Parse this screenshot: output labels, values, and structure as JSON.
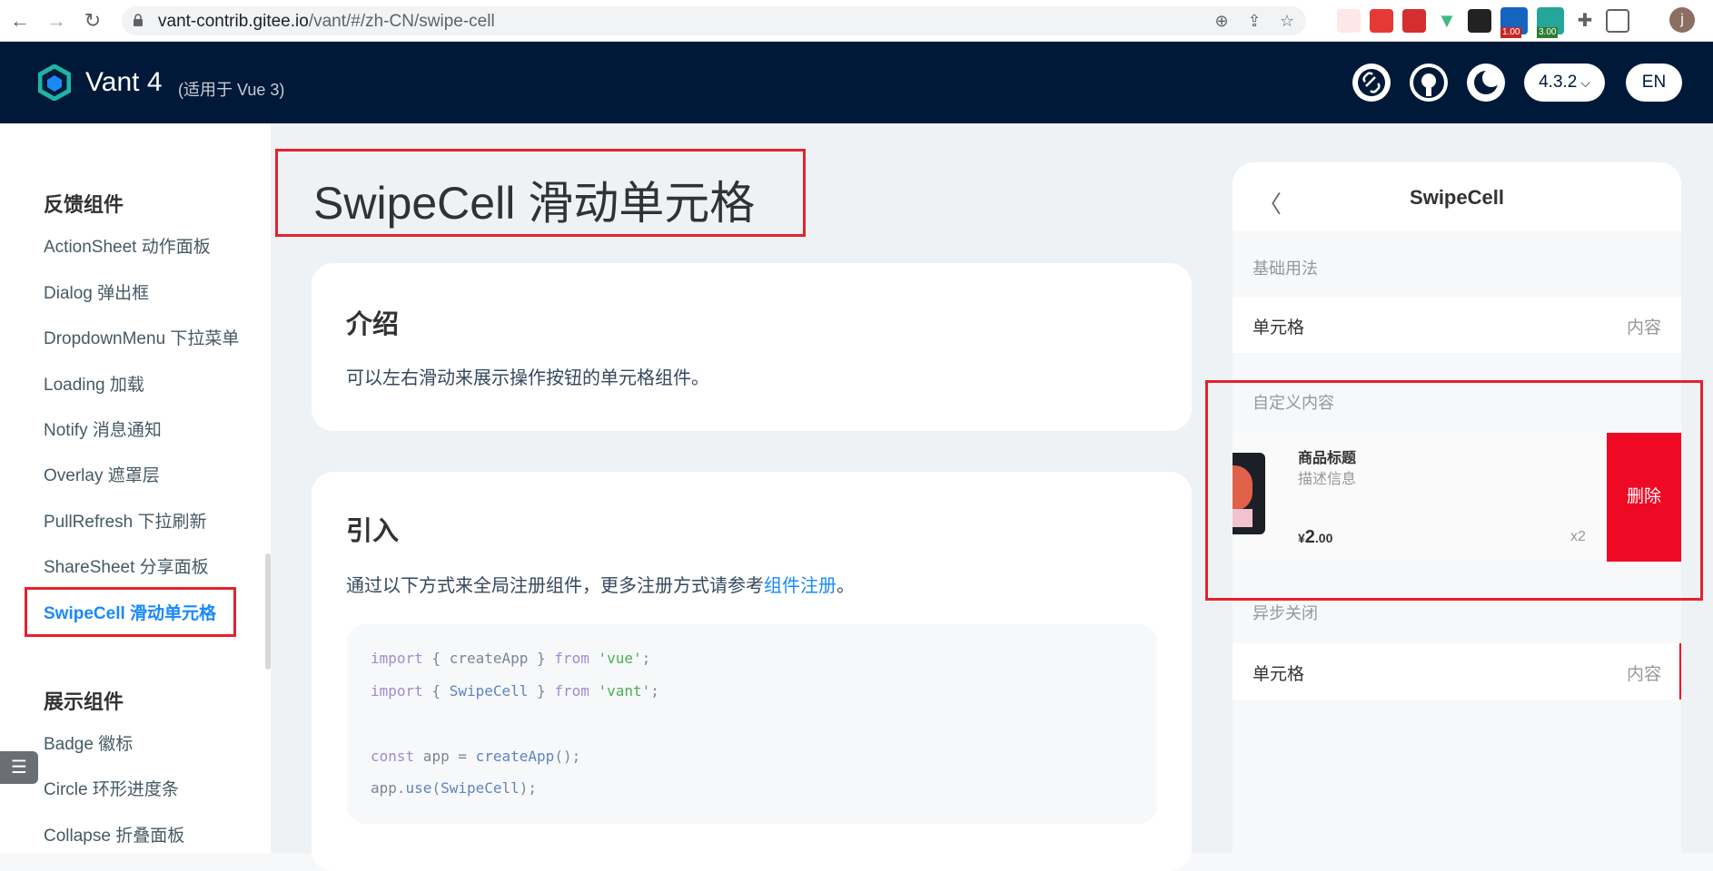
{
  "browser": {
    "url_host": "vant-contrib.gitee.io",
    "url_path": "/vant/#/zh-CN/swipe-cell",
    "ext_badge_1": "1.00",
    "ext_badge_2": "3.00",
    "avatar_letter": "j",
    "icons": [
      "back-icon",
      "forward-icon",
      "reload-icon",
      "lock-icon",
      "zoom-icon",
      "share-icon",
      "star-icon",
      "extensions-icon",
      "sidebar-icon"
    ]
  },
  "header": {
    "brand": "Vant 4",
    "brand_sub": "(适用于 Vue 3)",
    "version": "4.3.2",
    "lang": "EN",
    "colors": {
      "bg": "#001938",
      "accent": "#1989fa"
    }
  },
  "sidebar": {
    "groups": [
      {
        "title": "反馈组件",
        "items": [
          "ActionSheet 动作面板",
          "Dialog 弹出框",
          "DropdownMenu 下拉菜单",
          "Loading 加载",
          "Notify 消息通知",
          "Overlay 遮罩层",
          "PullRefresh 下拉刷新",
          "ShareSheet 分享面板",
          "SwipeCell 滑动单元格"
        ]
      },
      {
        "title": "展示组件",
        "items": [
          "Badge 徽标",
          "Circle 环形进度条",
          "Collapse 折叠面板"
        ]
      }
    ],
    "active_item": "SwipeCell 滑动单元格"
  },
  "main": {
    "title": "SwipeCell 滑动单元格",
    "intro": {
      "heading": "介绍",
      "text": "可以左右滑动来展示操作按钮的单元格组件。"
    },
    "import": {
      "heading": "引入",
      "text_before": "通过以下方式来全局注册组件，更多注册方式请参考",
      "link": "组件注册",
      "text_after": "。",
      "code": {
        "l1": {
          "a": "import",
          "b": " { createApp } ",
          "c": "from",
          "d": " 'vue'",
          "e": ";"
        },
        "l2": {
          "a": "import",
          "b": " { ",
          "c": "SwipeCell",
          "d": " } ",
          "e": "from",
          "f": " 'vant'",
          "g": ";"
        },
        "l3": {
          "a": "const",
          "b": " app = ",
          "c": "createApp",
          "d": "();"
        },
        "l4": {
          "a": "app.",
          "b": "use",
          "c": "(",
          "d": "SwipeCell",
          "e": ");"
        }
      }
    }
  },
  "preview": {
    "nav_title": "SwipeCell",
    "sections": {
      "basic": "基础用法",
      "custom": "自定义内容",
      "async": "异步关闭"
    },
    "cell": {
      "title": "单元格",
      "value": "内容"
    },
    "goods": {
      "title": "商品标题",
      "desc": "描述信息",
      "price_symbol": "¥",
      "price_int": "2",
      "price_dec": ".00",
      "num": "x2"
    },
    "delete_label": "删除"
  }
}
